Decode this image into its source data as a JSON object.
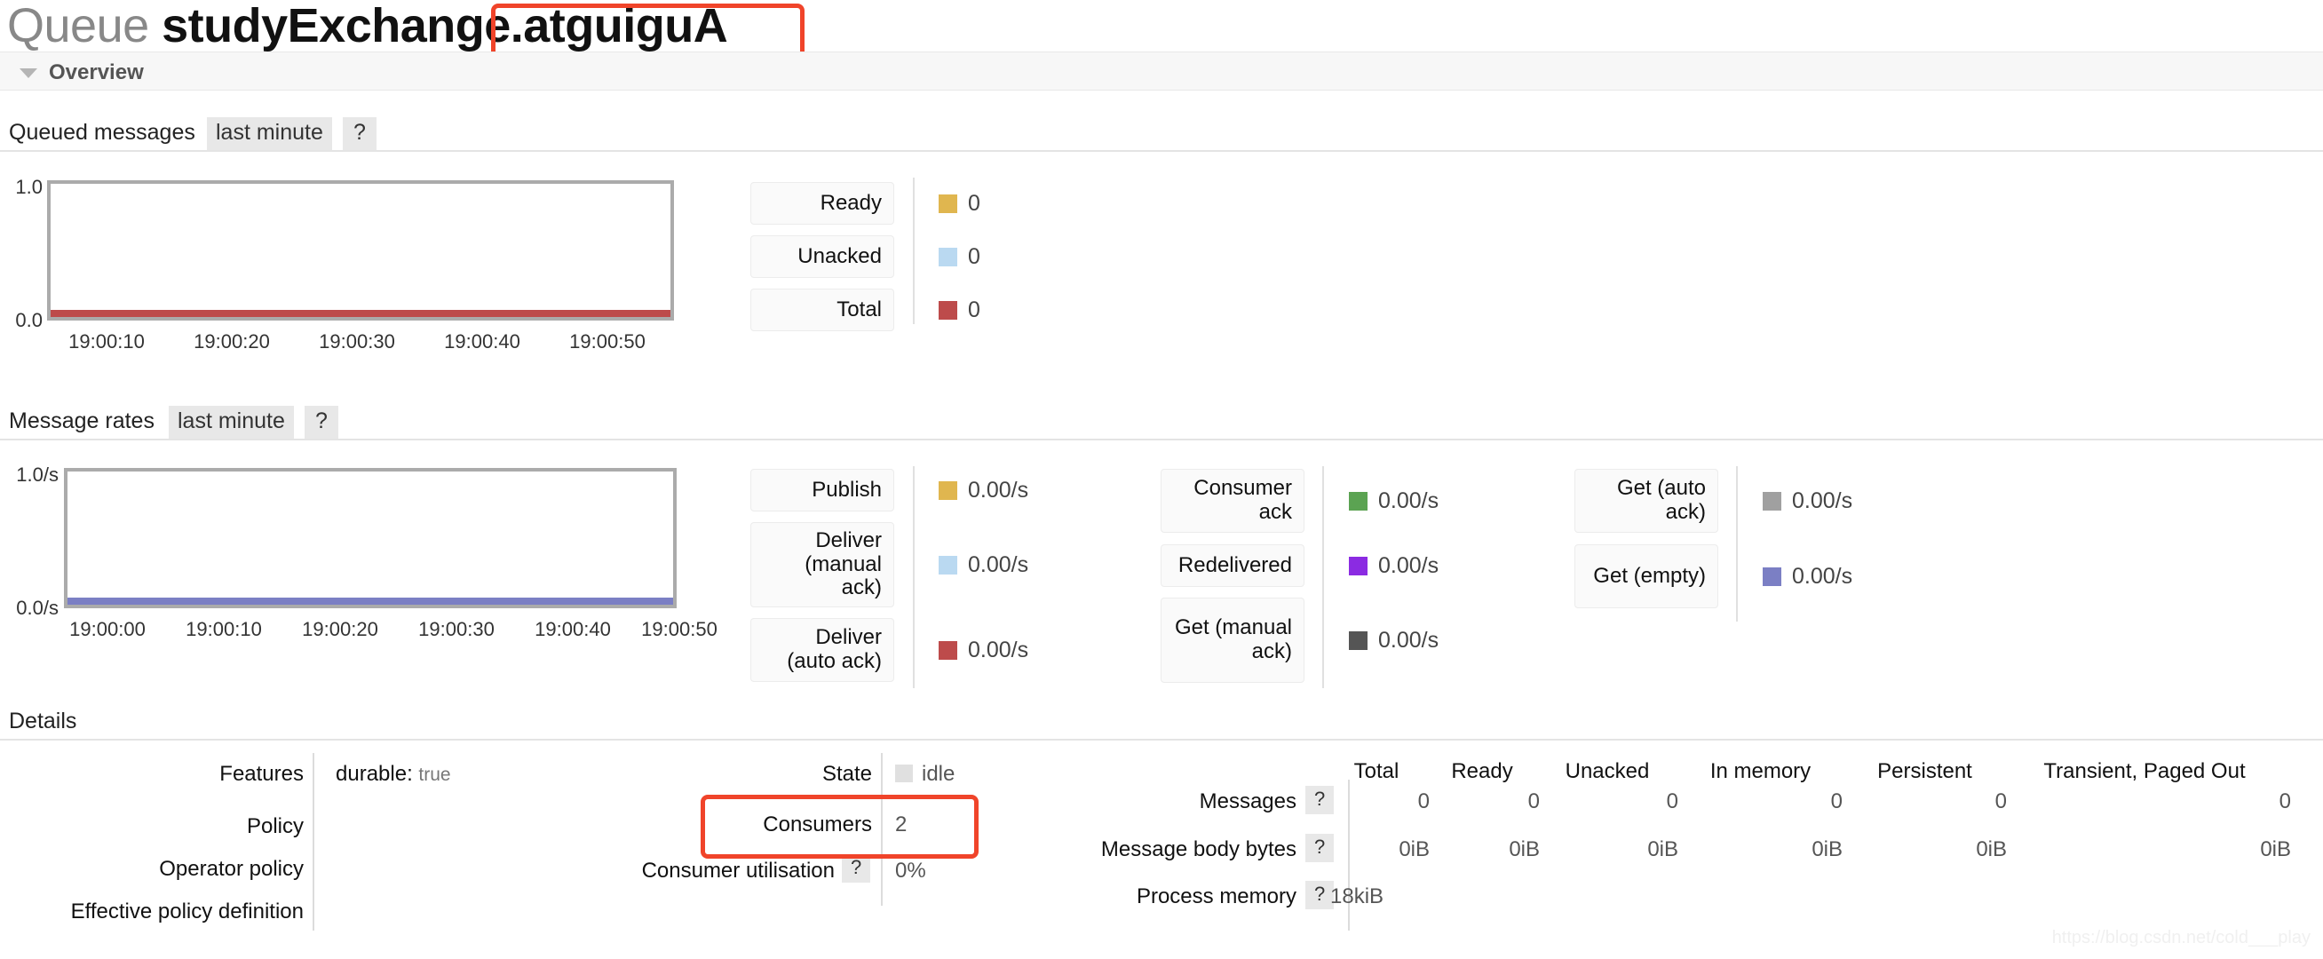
{
  "header": {
    "title_prefix": "Queue ",
    "title_main": "studyExchange.",
    "title_suffix": "atguiguA",
    "section_label": "Overview",
    "collapse_icon": "triangle-down-icon"
  },
  "queued_messages": {
    "heading": "Queued messages",
    "range_tab": "last minute",
    "help_tab": "?",
    "legend": [
      {
        "label": "Ready",
        "color": "#e0b64f",
        "value": "0"
      },
      {
        "label": "Unacked",
        "color": "#bad9f1",
        "value": "0"
      },
      {
        "label": "Total",
        "color": "#bd4b4b",
        "value": "0"
      }
    ]
  },
  "message_rates": {
    "heading": "Message rates",
    "range_tab": "last minute",
    "help_tab": "?",
    "legend_col1": [
      {
        "label": "Publish",
        "color": "#e0b64f",
        "value": "0.00/s"
      },
      {
        "label": "Deliver (manual ack)",
        "color": "#bad9f1",
        "value": "0.00/s"
      },
      {
        "label": "Deliver (auto ack)",
        "color": "#bd4b4b",
        "value": "0.00/s"
      }
    ],
    "legend_col2": [
      {
        "label": "Consumer ack",
        "color": "#5ba košice",
        "value": "0.00/s"
      },
      {
        "label": "Redelivered",
        "color": "#8b2be2",
        "value": "0.00/s"
      },
      {
        "label": "Get (manual ack)",
        "color": "#555555",
        "value": "0.00/s"
      }
    ],
    "legend_col3": [
      {
        "label": "Get (auto ack)",
        "color": "#a0a0a0",
        "value": "0.00/s"
      },
      {
        "label": "Get (empty)",
        "color": "#7b7fc4",
        "value": "0.00/s"
      }
    ]
  },
  "details": {
    "heading": "Details",
    "left_labels": [
      "Features",
      "Policy",
      "Operator policy",
      "Effective policy definition"
    ],
    "features_key": "durable:",
    "features_value": "true",
    "mid_labels": [
      "State",
      "Consumers",
      "Consumer utilisation"
    ],
    "consumer_util_help": "?",
    "state_value": "idle",
    "consumers_value": "2",
    "consumer_utilisation_value": "0%"
  },
  "stats": {
    "columns": [
      "Total",
      "Ready",
      "Unacked",
      "In memory",
      "Persistent",
      "Transient, Paged Out"
    ],
    "rows": [
      {
        "label": "Messages",
        "help": "?",
        "values": [
          "0",
          "0",
          "0",
          "0",
          "0",
          "0"
        ]
      },
      {
        "label": "Message body bytes",
        "help": "?",
        "values": [
          "0iB",
          "0iB",
          "0iB",
          "0iB",
          "0iB",
          "0iB"
        ]
      },
      {
        "label": "Process memory",
        "help": "?",
        "values": [
          "18kiB",
          "",
          "",
          "",
          "",
          ""
        ]
      }
    ]
  },
  "watermark": "https://blog.csdn.net/cold___play",
  "chart_data": [
    {
      "type": "line",
      "title": "Queued messages",
      "subtitle": "last minute",
      "xlabel": "",
      "ylabel": "",
      "ylim": [
        0.0,
        1.0
      ],
      "ytick_labels": [
        "0.0",
        "1.0"
      ],
      "x": [
        "19:00:10",
        "19:00:20",
        "19:00:30",
        "19:00:40",
        "19:00:50"
      ],
      "grid": false,
      "legend_position": "right",
      "series": [
        {
          "name": "Ready",
          "color": "#e0b64f",
          "values": [
            0,
            0,
            0,
            0,
            0
          ]
        },
        {
          "name": "Unacked",
          "color": "#bad9f1",
          "values": [
            0,
            0,
            0,
            0,
            0
          ]
        },
        {
          "name": "Total",
          "color": "#bd4b4b",
          "values": [
            0,
            0,
            0,
            0,
            0
          ]
        }
      ]
    },
    {
      "type": "line",
      "title": "Message rates",
      "subtitle": "last minute",
      "xlabel": "",
      "ylabel": "",
      "ylim": [
        0.0,
        1.0
      ],
      "ytick_labels": [
        "0.0/s",
        "1.0/s"
      ],
      "x": [
        "19:00:00",
        "19:00:10",
        "19:00:20",
        "19:00:30",
        "19:00:40",
        "19:00:50"
      ],
      "grid": false,
      "legend_position": "right",
      "series": [
        {
          "name": "Publish",
          "color": "#e0b64f",
          "values": [
            0,
            0,
            0,
            0,
            0,
            0
          ]
        },
        {
          "name": "Deliver (manual ack)",
          "color": "#bad9f1",
          "values": [
            0,
            0,
            0,
            0,
            0,
            0
          ]
        },
        {
          "name": "Deliver (auto ack)",
          "color": "#bd4b4b",
          "values": [
            0,
            0,
            0,
            0,
            0,
            0
          ]
        },
        {
          "name": "Consumer ack",
          "color": "#5ba352",
          "values": [
            0,
            0,
            0,
            0,
            0,
            0
          ]
        },
        {
          "name": "Redelivered",
          "color": "#8b2be2",
          "values": [
            0,
            0,
            0,
            0,
            0,
            0
          ]
        },
        {
          "name": "Get (manual ack)",
          "color": "#555555",
          "values": [
            0,
            0,
            0,
            0,
            0,
            0
          ]
        },
        {
          "name": "Get (auto ack)",
          "color": "#a0a0a0",
          "values": [
            0,
            0,
            0,
            0,
            0,
            0
          ]
        },
        {
          "name": "Get (empty)",
          "color": "#7b7fc4",
          "values": [
            0,
            0,
            0,
            0,
            0,
            0
          ]
        }
      ]
    }
  ]
}
